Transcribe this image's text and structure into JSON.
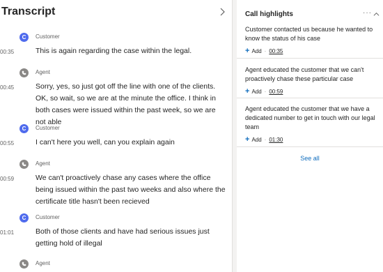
{
  "transcript": {
    "title": "Transcript",
    "entries": [
      {
        "speaker": "Customer",
        "role": "customer",
        "initial": "C",
        "time": "00:35",
        "text": "This is again regarding the case within the legal."
      },
      {
        "speaker": "Agent",
        "role": "agent",
        "initial": "",
        "time": "00:45",
        "text": "Sorry, yes, so just got off the line with one of the clients. OK, so wait, so we are at the minute the office. I think in both cases were issued within the past week, so we are not able"
      },
      {
        "speaker": "Customer",
        "role": "customer",
        "initial": "C",
        "time": "00:55",
        "text": "I can't here you well, can you explain again"
      },
      {
        "speaker": "Agent",
        "role": "agent",
        "initial": "",
        "time": "00:59",
        "text": "We can't proactively chase any cases where the office being issued within the past two weeks and also where the certificate title hasn't been recieved"
      },
      {
        "speaker": "Customer",
        "role": "customer",
        "initial": "C",
        "time": "01:01",
        "text": "Both of those clients and have had serious issues just getting hold of illegal"
      },
      {
        "speaker": "Agent",
        "role": "agent",
        "initial": "",
        "time": "",
        "text": ""
      }
    ]
  },
  "highlights": {
    "title": "Call highlights",
    "more_label": "···",
    "items": [
      {
        "text": "Customer contacted us because he wanted to know the status of his case",
        "add_label": "Add",
        "time": "00:35"
      },
      {
        "text": "Agent educated the customer that we can't proactively chase these particular case",
        "add_label": "Add",
        "time": "00:59"
      },
      {
        "text": "Agent educated the customer that we have a dedicated number to get in touch with our legal team",
        "add_label": "Add",
        "time": "01:30"
      }
    ],
    "see_all_label": "See all"
  },
  "colors": {
    "accent": "#0f6cbd",
    "customer_avatar": "#4f6bed",
    "agent_avatar": "#8a8886"
  },
  "icons": {
    "expand": "chevron-right-icon",
    "collapse": "chevron-up-icon",
    "agent": "phone-icon"
  }
}
